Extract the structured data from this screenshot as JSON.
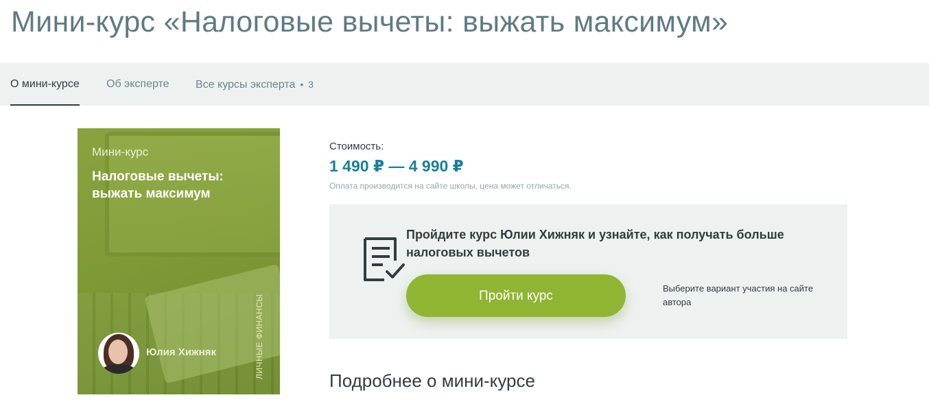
{
  "page": {
    "title": "Мини-курс «Налоговые вычеты: выжать максимум»"
  },
  "tabs": [
    {
      "label": "О мини-курсе",
      "active": true
    },
    {
      "label": "Об эксперте",
      "active": false
    },
    {
      "label": "Все курсы эксперта",
      "active": false,
      "count": "3"
    }
  ],
  "tab_separator": "•",
  "cover": {
    "subtitle": "Мини-курс",
    "heading": "Налоговые вычеты: выжать максимум",
    "author": "Юлия Хижняк",
    "category": "ЛИЧНЫЕ ФИНАНСЫ"
  },
  "pricing": {
    "label": "Стоимость:",
    "range": "1 490 ₽ — 4 990 ₽",
    "note": "Оплата производится на сайте школы, цена может отличаться."
  },
  "promo": {
    "text": "Пройдите курс Юлии Хижняк и узнайте, как получать больше налоговых вычетов",
    "button_label": "Пройти курс",
    "side_note": "Выберите вариант участия на сайте автора",
    "icon": "document-check-icon"
  },
  "details": {
    "heading": "Подробнее о мини-курсе"
  },
  "colors": {
    "accent": "#8fb533",
    "price": "#18809a",
    "title": "#5f7b83",
    "panel": "#edf2f1"
  }
}
